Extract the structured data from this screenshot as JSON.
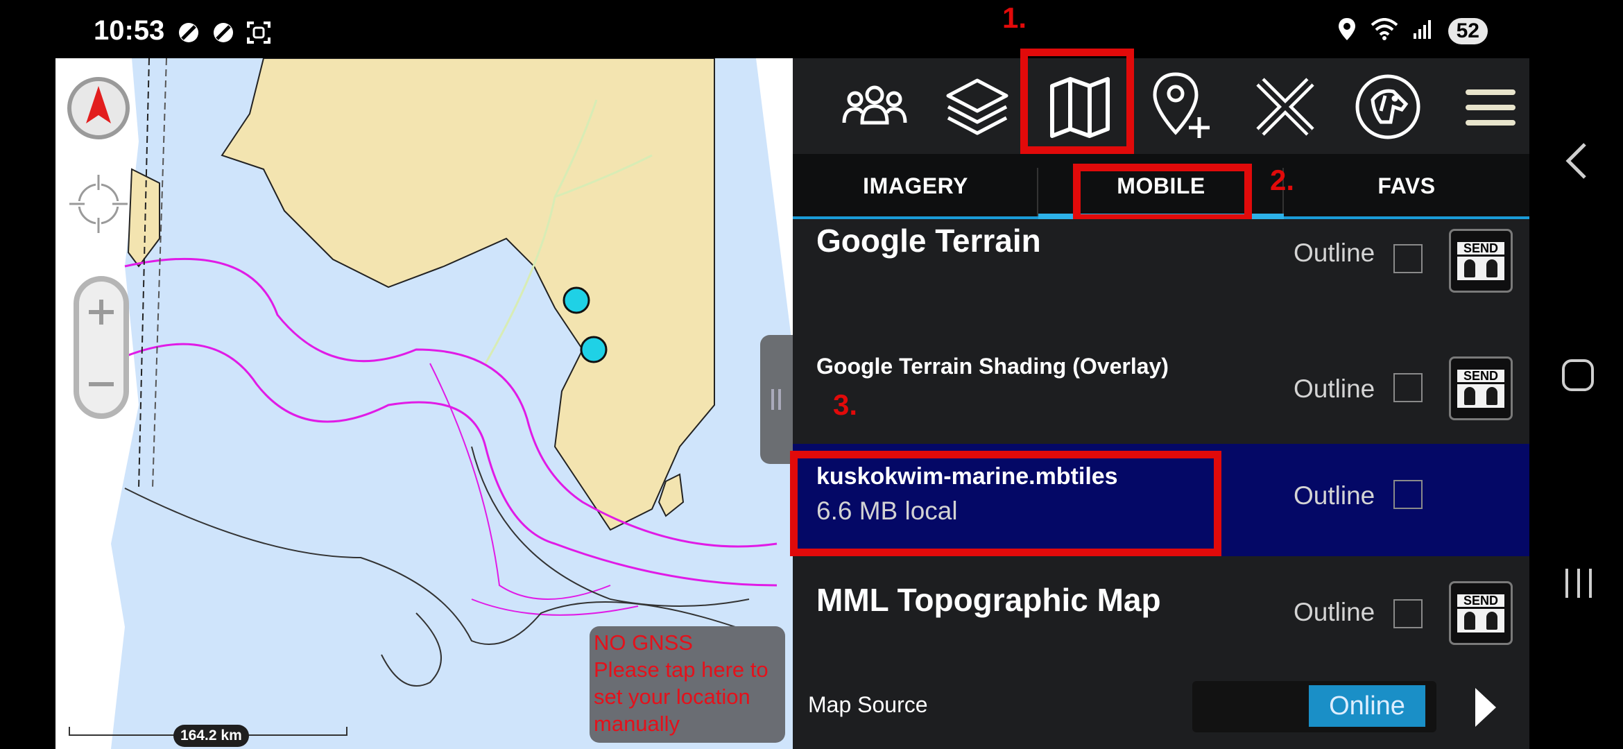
{
  "status_bar": {
    "time": "10:53",
    "battery": "52",
    "left_icons": [
      "dnd-icon",
      "dnd-icon",
      "screenshot-icon"
    ],
    "right_icons": [
      "location-icon",
      "wifi-icon",
      "signal-icon"
    ]
  },
  "map": {
    "scale_label": "164.2 km",
    "no_gnss_lines": [
      "NO GNSS",
      "Please tap here to",
      "set your location",
      "manually"
    ],
    "land_color": "#f3e4b0",
    "water_color": "#cfe4fb",
    "route_color": "#e01be6",
    "marker_color": "#1fd1e6"
  },
  "toolbar": {
    "buttons": [
      "people-icon",
      "layers-icon",
      "map-icon",
      "add-waypoint-icon",
      "close-icon",
      "dog-tracker-icon",
      "menu-icon"
    ]
  },
  "annotations": {
    "step1": "1.",
    "step2": "2.",
    "step3": "3.",
    "highlight_color": "#e10a0a"
  },
  "tabs": [
    {
      "label": "IMAGERY"
    },
    {
      "label": "MOBILE"
    },
    {
      "label": "FAVS"
    }
  ],
  "map_list": [
    {
      "title": "Google Terrain",
      "outline": "Outline",
      "send": "SEND"
    },
    {
      "title": "Google Terrain Shading (Overlay)",
      "outline": "Outline",
      "send": "SEND"
    },
    {
      "title": "kuskokwim-marine.mbtiles",
      "subtitle": "6.6 MB local",
      "outline": "Outline"
    },
    {
      "title": "MML Topographic Map",
      "outline": "Outline",
      "send": "SEND"
    }
  ],
  "bottom": {
    "map_source_label": "Map Source",
    "map_source_value": "Online"
  }
}
